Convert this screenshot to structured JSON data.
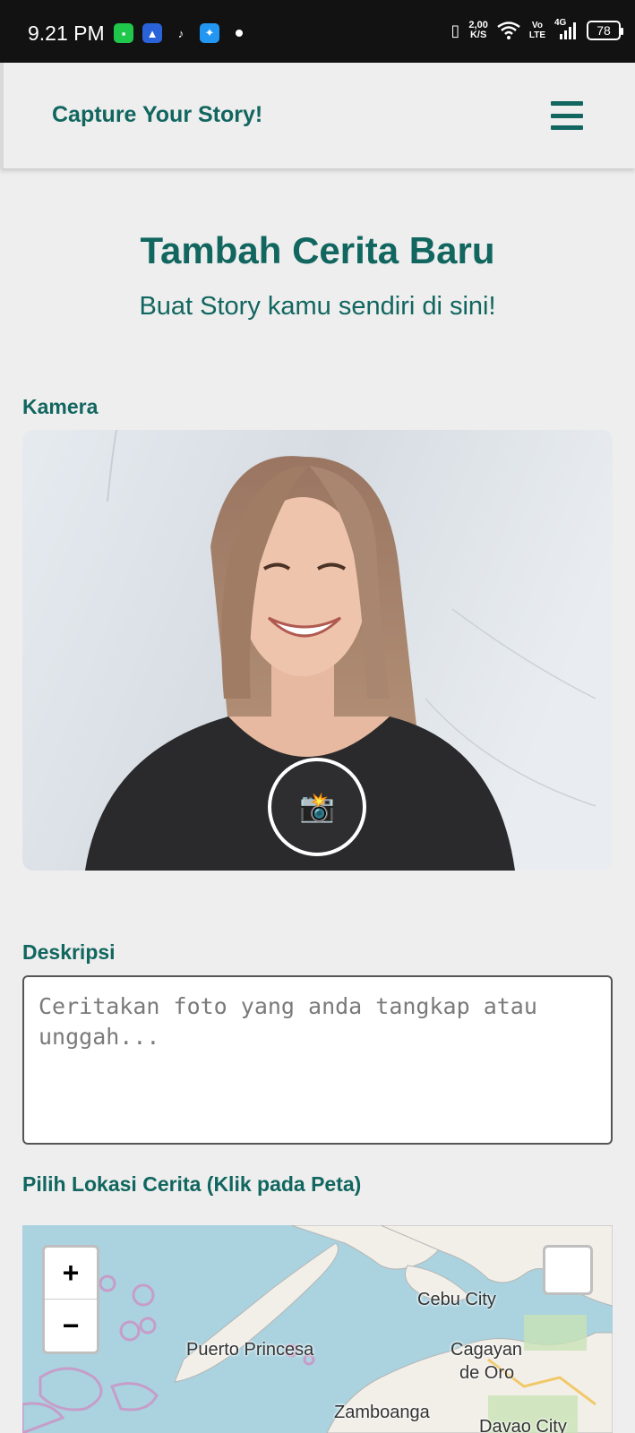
{
  "status_bar": {
    "time": "9.21 PM",
    "net_speed_value": "2,00",
    "net_speed_unit": "K/S",
    "volte_top": "Vo",
    "volte_bottom": "LTE",
    "network": "4G",
    "battery": "78",
    "app_icons": [
      "messages-icon",
      "drive-icon",
      "tiktok-icon",
      "bird-app-icon"
    ]
  },
  "header": {
    "brand": "Capture Your Story!",
    "menu_icon": "hamburger-menu-icon"
  },
  "page": {
    "title": "Tambah Cerita Baru",
    "subtitle": "Buat Story kamu sendiri di sini!"
  },
  "camera": {
    "label": "Kamera",
    "capture_icon": "📸"
  },
  "description": {
    "label": "Deskripsi",
    "placeholder": "Ceritakan foto yang anda tangkap atau unggah...",
    "value": ""
  },
  "location": {
    "label": "Pilih Lokasi Cerita (Klik pada Peta)",
    "zoom_in": "+",
    "zoom_out": "−",
    "cities": [
      "Cebu City",
      "Puerto Princesa",
      "Cagayan",
      "de Oro",
      "Zamboanga",
      "Davao City"
    ]
  },
  "colors": {
    "primary": "#11665f",
    "background": "#eeeeee",
    "status_bar": "#121212",
    "map_water": "#aad3df"
  }
}
